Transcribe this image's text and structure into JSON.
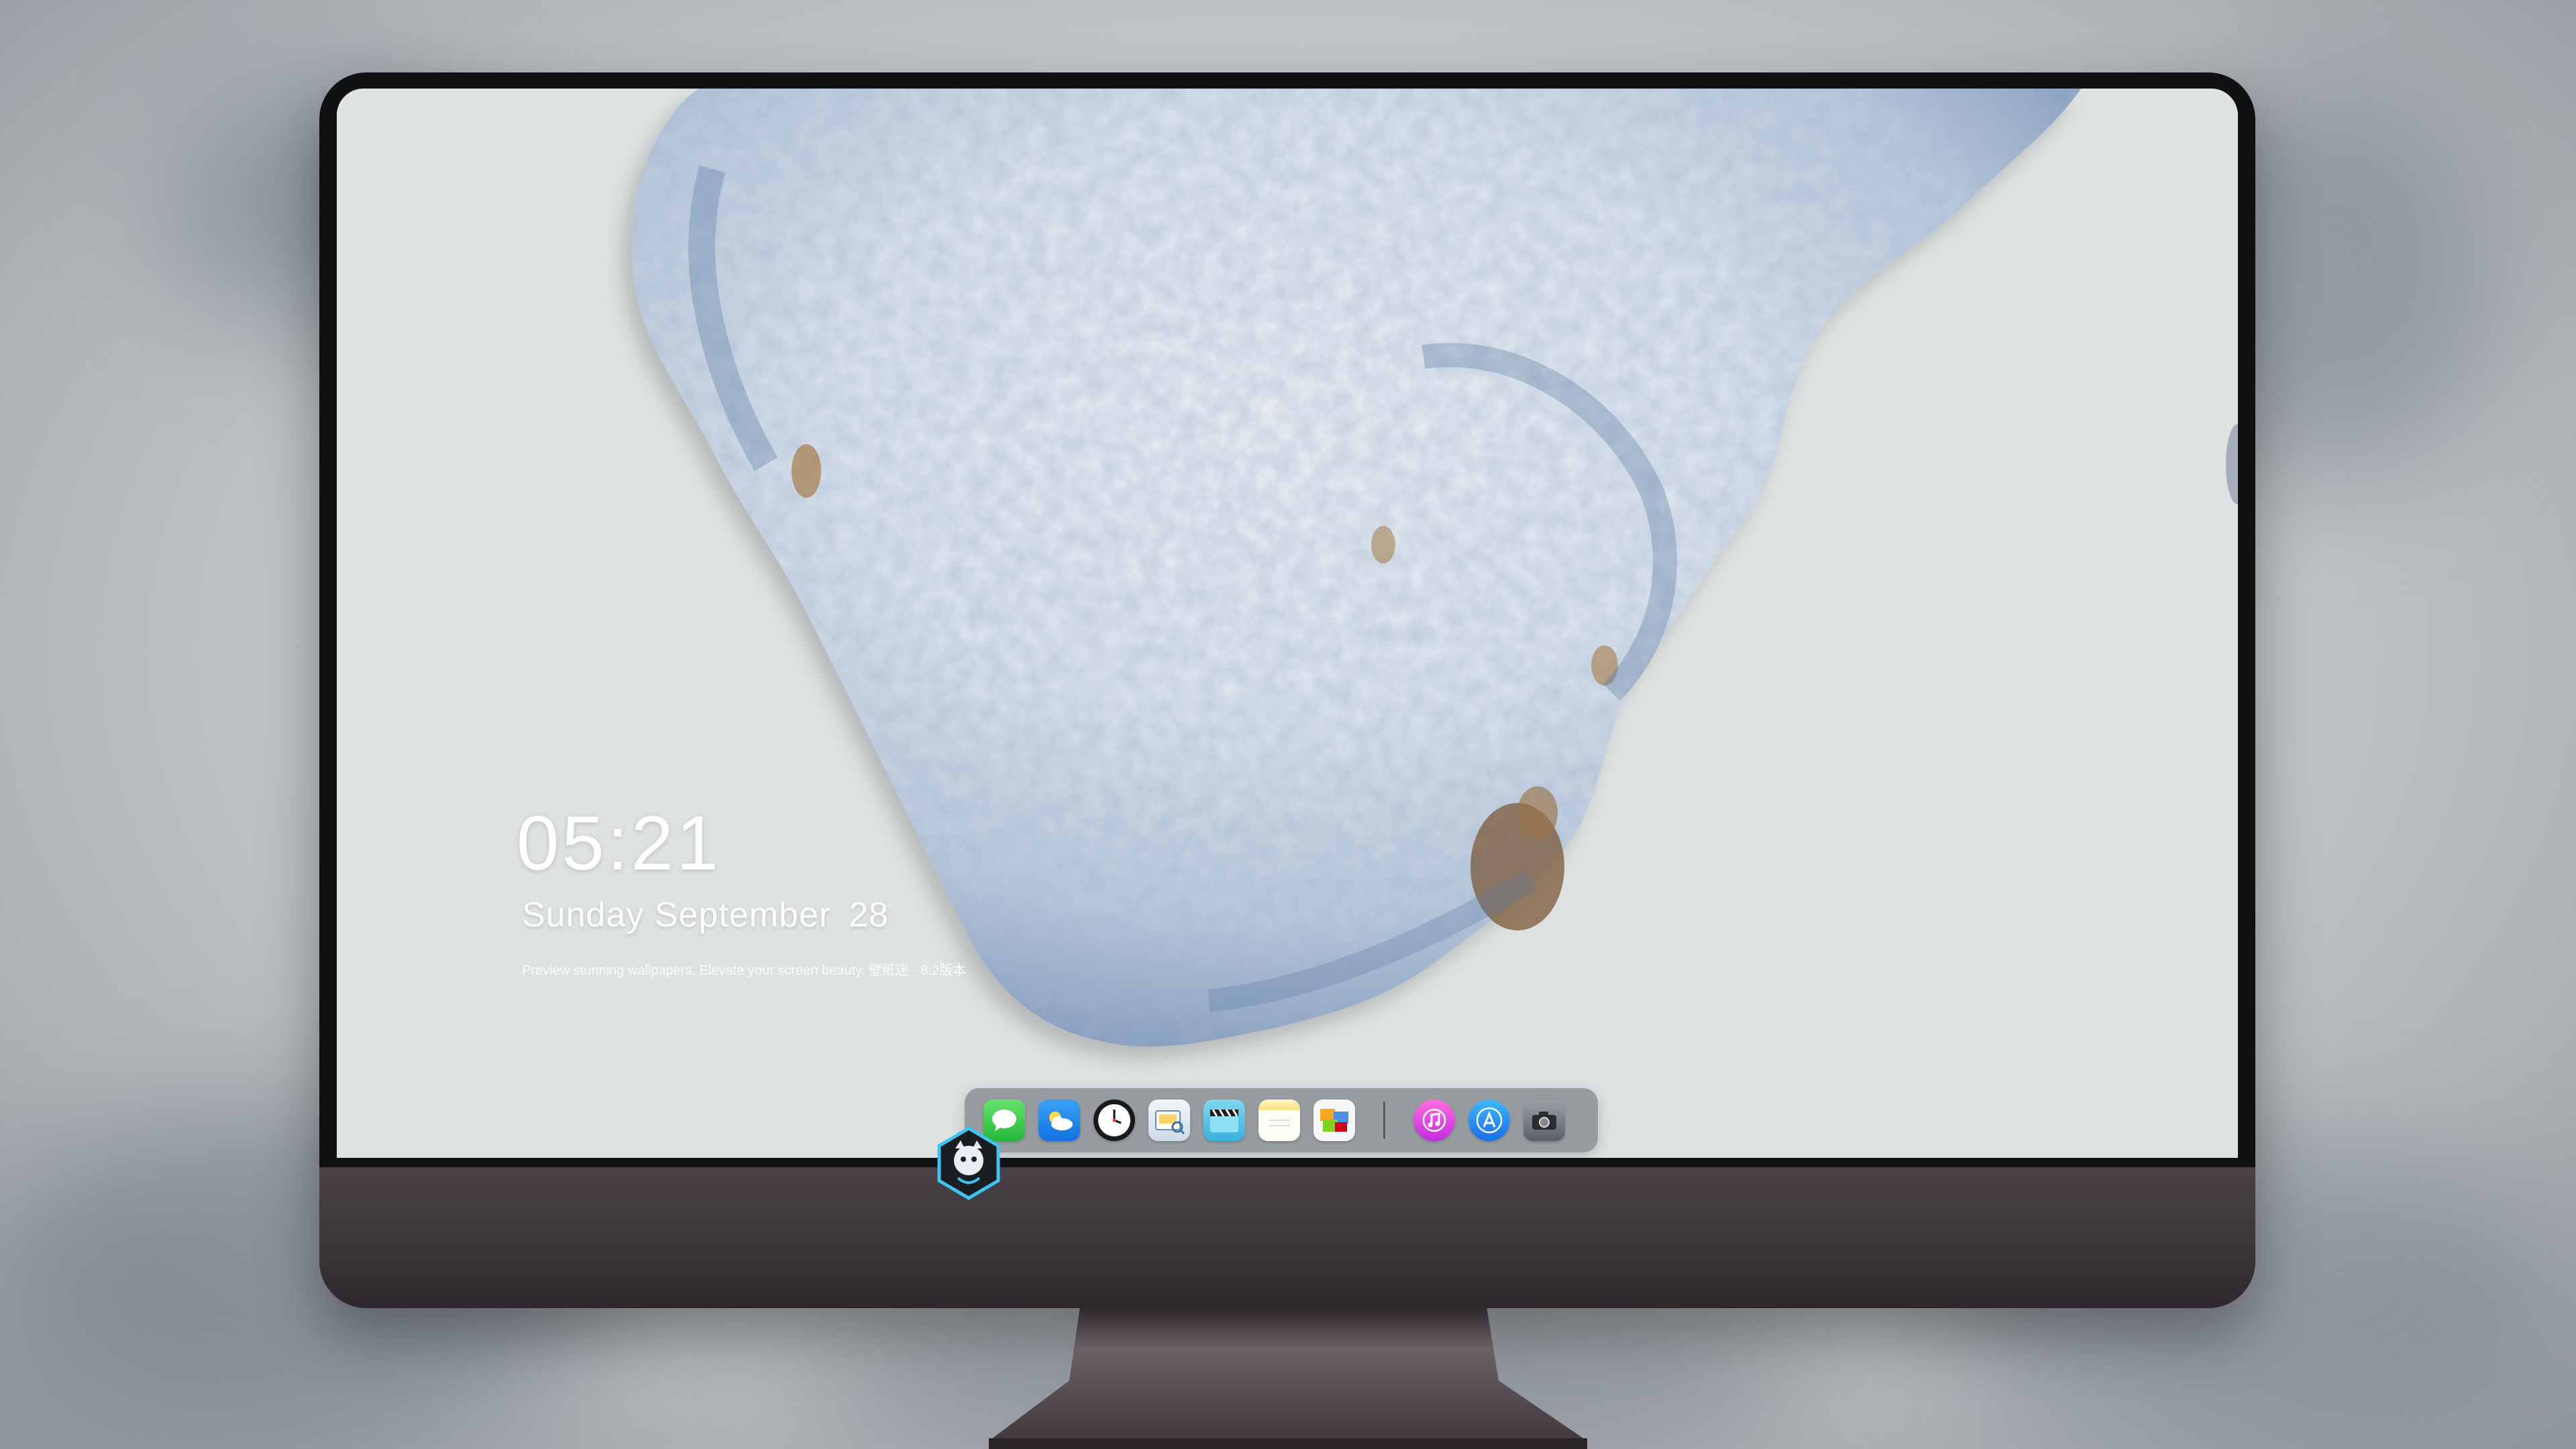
{
  "lock_screen": {
    "time": "05:21",
    "date_weekday_month": "Sunday September",
    "date_day": "28",
    "tagline": "Preview stunning wallpapers. Elevate your screen beauty. 壁纸迷 · 8.2版本"
  },
  "dock": {
    "apps": [
      {
        "name": "messages-icon"
      },
      {
        "name": "weather-icon"
      },
      {
        "name": "clock-icon"
      },
      {
        "name": "preview-icon"
      },
      {
        "name": "video-clapper-icon"
      },
      {
        "name": "notes-icon"
      },
      {
        "name": "photos-icon"
      },
      {
        "name": "music-icon"
      },
      {
        "name": "app-store-icon"
      },
      {
        "name": "camera-icon"
      }
    ]
  },
  "colors": {
    "bezel": "#101112",
    "chin": "#3b3438",
    "screen_bg": "#dfe2e2",
    "relief_blue": "#6f8bb0",
    "relief_brown": "#7a5a38"
  }
}
